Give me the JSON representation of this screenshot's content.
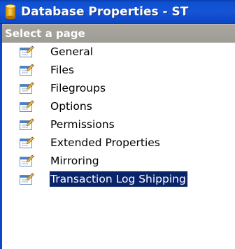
{
  "window": {
    "title": "Database Properties - ST",
    "title_icon": "database-cylinder-icon"
  },
  "panel": {
    "header": "Select a page"
  },
  "pages": [
    {
      "label": "General",
      "icon": "property-page-icon",
      "selected": false
    },
    {
      "label": "Files",
      "icon": "property-page-icon",
      "selected": false
    },
    {
      "label": "Filegroups",
      "icon": "property-page-icon",
      "selected": false
    },
    {
      "label": "Options",
      "icon": "property-page-icon",
      "selected": false
    },
    {
      "label": "Permissions",
      "icon": "property-page-icon",
      "selected": false
    },
    {
      "label": "Extended Properties",
      "icon": "property-page-icon",
      "selected": false
    },
    {
      "label": "Mirroring",
      "icon": "property-page-icon",
      "selected": false
    },
    {
      "label": "Transaction Log Shipping",
      "icon": "property-page-icon",
      "selected": true
    }
  ],
  "colors": {
    "titlebar": "#1654d6",
    "header_band": "#a5a29c",
    "selection": "#0a246a"
  }
}
